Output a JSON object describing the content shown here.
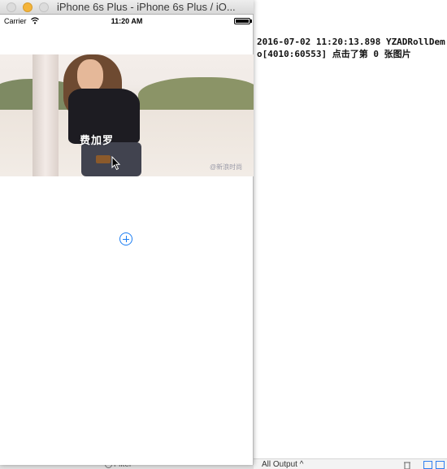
{
  "simulator": {
    "window_title": "iPhone 6s Plus - iPhone 6s Plus / iO...",
    "status_bar": {
      "carrier": "Carrier",
      "time": "11:20 AM"
    },
    "banner": {
      "overlay_text": "费加罗",
      "watermark": "@新浪时尚"
    }
  },
  "console": {
    "log_text": "2016-07-02 11:20:13.898 YZADRollDemo[4010:60553] 点击了第 0 张图片",
    "output_selector": "All Output ^",
    "filter_label": "Filter"
  },
  "colors": {
    "accent": "#1c7ef3",
    "window_minimize": "#f4b43a"
  },
  "icons": [
    "wifi-icon",
    "battery-icon",
    "add-icon",
    "trash-icon",
    "filter-icon",
    "mouse-pointer-icon"
  ]
}
